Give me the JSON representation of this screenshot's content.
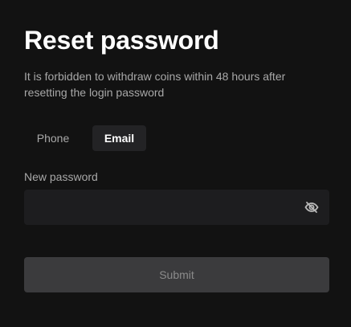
{
  "page": {
    "title": "Reset password",
    "subtitle": "It is forbidden to withdraw coins within 48 hours after resetting the login password"
  },
  "tabs": [
    {
      "label": "Phone",
      "selected": false
    },
    {
      "label": "Email",
      "selected": true
    }
  ],
  "password_field": {
    "label": "New password",
    "value": "",
    "placeholder": "",
    "icon": "eye-off-icon"
  },
  "actions": {
    "submit_label": "Submit"
  },
  "colors": {
    "background": "#121212",
    "text_primary": "#ffffff",
    "text_secondary": "#a8a8a8",
    "input_background": "#1d1d1f",
    "selected_tab_background": "#232325",
    "submit_background": "#3b3b3d",
    "submit_text": "#8b8b8b"
  }
}
